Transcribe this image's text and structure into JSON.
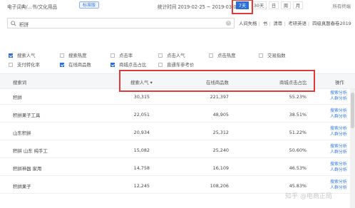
{
  "topbar": {
    "category": "电子词典/...书/文化用品",
    "badge": "标准版",
    "stat_period": "统计时间 2019-02-25 ~ 2019-03-03",
    "ranges": [
      "7天",
      "30天",
      "日",
      "周",
      "月"
    ],
    "active_range": "7天",
    "all_link": "所有终端"
  },
  "search": {
    "value": "积拼",
    "quick_links": [
      "人间失格",
      "书",
      "清尊",
      "考研英语",
      "四级真题春卷2019"
    ]
  },
  "filters": [
    {
      "label": "搜索人气",
      "checked": true
    },
    {
      "label": "搜索热度",
      "checked": false
    },
    {
      "label": "点击率",
      "checked": false
    },
    {
      "label": "点击人气",
      "checked": false
    },
    {
      "label": "点击热度",
      "checked": false
    },
    {
      "label": "交易指数",
      "checked": false
    },
    {
      "label": "支付转化率",
      "checked": false
    },
    {
      "label": "在线商品数",
      "checked": true
    },
    {
      "label": "商城点击占比",
      "checked": true
    },
    {
      "label": "直通车参考价",
      "checked": false
    }
  ],
  "table": {
    "columns": [
      "搜索词",
      "搜索人气",
      "在线商品数",
      "商城点击占比",
      "操作"
    ],
    "rows": [
      {
        "term": "积拼",
        "popularity": "30,315",
        "items": "221,397",
        "ratio": "55.23%"
      },
      {
        "term": "积拼果子工具",
        "popularity": "22,051",
        "items": "48,905",
        "ratio": "38.51%"
      },
      {
        "term": "山东积拼",
        "popularity": "20,934",
        "items": "25,312",
        "ratio": "51.22%"
      },
      {
        "term": "积拼 山东 纯手工",
        "popularity": "15,082",
        "items": "25,240",
        "ratio": "50.60%"
      },
      {
        "term": "积拼神器 家用",
        "popularity": "14,758",
        "items": "16,109",
        "ratio": "46.53%"
      },
      {
        "term": "积拼果子",
        "popularity": "12,245",
        "items": "108,206",
        "ratio": "45.83%"
      }
    ],
    "action_links": [
      "搜索分析",
      "人群分析"
    ]
  },
  "watermark": "知乎 @电商正局"
}
